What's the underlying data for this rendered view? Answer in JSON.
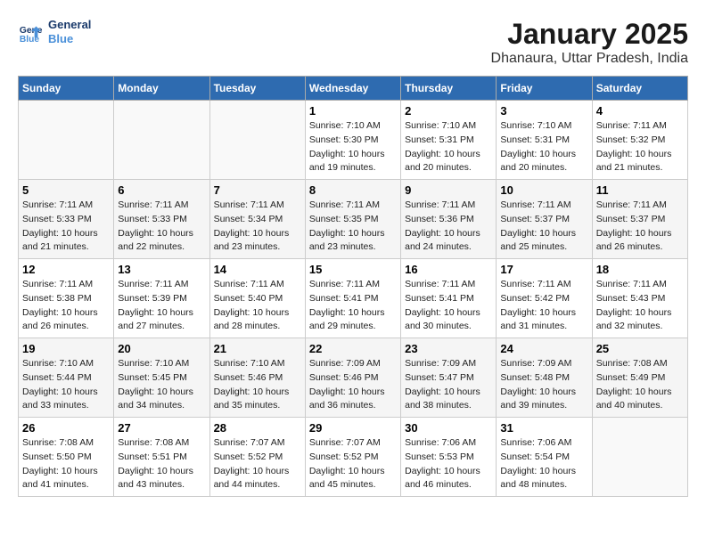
{
  "logo": {
    "line1": "General",
    "line2": "Blue"
  },
  "title": "January 2025",
  "subtitle": "Dhanaura, Uttar Pradesh, India",
  "days_of_week": [
    "Sunday",
    "Monday",
    "Tuesday",
    "Wednesday",
    "Thursday",
    "Friday",
    "Saturday"
  ],
  "weeks": [
    [
      {
        "num": "",
        "info": ""
      },
      {
        "num": "",
        "info": ""
      },
      {
        "num": "",
        "info": ""
      },
      {
        "num": "1",
        "info": "Sunrise: 7:10 AM\nSunset: 5:30 PM\nDaylight: 10 hours\nand 19 minutes."
      },
      {
        "num": "2",
        "info": "Sunrise: 7:10 AM\nSunset: 5:31 PM\nDaylight: 10 hours\nand 20 minutes."
      },
      {
        "num": "3",
        "info": "Sunrise: 7:10 AM\nSunset: 5:31 PM\nDaylight: 10 hours\nand 20 minutes."
      },
      {
        "num": "4",
        "info": "Sunrise: 7:11 AM\nSunset: 5:32 PM\nDaylight: 10 hours\nand 21 minutes."
      }
    ],
    [
      {
        "num": "5",
        "info": "Sunrise: 7:11 AM\nSunset: 5:33 PM\nDaylight: 10 hours\nand 21 minutes."
      },
      {
        "num": "6",
        "info": "Sunrise: 7:11 AM\nSunset: 5:33 PM\nDaylight: 10 hours\nand 22 minutes."
      },
      {
        "num": "7",
        "info": "Sunrise: 7:11 AM\nSunset: 5:34 PM\nDaylight: 10 hours\nand 23 minutes."
      },
      {
        "num": "8",
        "info": "Sunrise: 7:11 AM\nSunset: 5:35 PM\nDaylight: 10 hours\nand 23 minutes."
      },
      {
        "num": "9",
        "info": "Sunrise: 7:11 AM\nSunset: 5:36 PM\nDaylight: 10 hours\nand 24 minutes."
      },
      {
        "num": "10",
        "info": "Sunrise: 7:11 AM\nSunset: 5:37 PM\nDaylight: 10 hours\nand 25 minutes."
      },
      {
        "num": "11",
        "info": "Sunrise: 7:11 AM\nSunset: 5:37 PM\nDaylight: 10 hours\nand 26 minutes."
      }
    ],
    [
      {
        "num": "12",
        "info": "Sunrise: 7:11 AM\nSunset: 5:38 PM\nDaylight: 10 hours\nand 26 minutes."
      },
      {
        "num": "13",
        "info": "Sunrise: 7:11 AM\nSunset: 5:39 PM\nDaylight: 10 hours\nand 27 minutes."
      },
      {
        "num": "14",
        "info": "Sunrise: 7:11 AM\nSunset: 5:40 PM\nDaylight: 10 hours\nand 28 minutes."
      },
      {
        "num": "15",
        "info": "Sunrise: 7:11 AM\nSunset: 5:41 PM\nDaylight: 10 hours\nand 29 minutes."
      },
      {
        "num": "16",
        "info": "Sunrise: 7:11 AM\nSunset: 5:41 PM\nDaylight: 10 hours\nand 30 minutes."
      },
      {
        "num": "17",
        "info": "Sunrise: 7:11 AM\nSunset: 5:42 PM\nDaylight: 10 hours\nand 31 minutes."
      },
      {
        "num": "18",
        "info": "Sunrise: 7:11 AM\nSunset: 5:43 PM\nDaylight: 10 hours\nand 32 minutes."
      }
    ],
    [
      {
        "num": "19",
        "info": "Sunrise: 7:10 AM\nSunset: 5:44 PM\nDaylight: 10 hours\nand 33 minutes."
      },
      {
        "num": "20",
        "info": "Sunrise: 7:10 AM\nSunset: 5:45 PM\nDaylight: 10 hours\nand 34 minutes."
      },
      {
        "num": "21",
        "info": "Sunrise: 7:10 AM\nSunset: 5:46 PM\nDaylight: 10 hours\nand 35 minutes."
      },
      {
        "num": "22",
        "info": "Sunrise: 7:09 AM\nSunset: 5:46 PM\nDaylight: 10 hours\nand 36 minutes."
      },
      {
        "num": "23",
        "info": "Sunrise: 7:09 AM\nSunset: 5:47 PM\nDaylight: 10 hours\nand 38 minutes."
      },
      {
        "num": "24",
        "info": "Sunrise: 7:09 AM\nSunset: 5:48 PM\nDaylight: 10 hours\nand 39 minutes."
      },
      {
        "num": "25",
        "info": "Sunrise: 7:08 AM\nSunset: 5:49 PM\nDaylight: 10 hours\nand 40 minutes."
      }
    ],
    [
      {
        "num": "26",
        "info": "Sunrise: 7:08 AM\nSunset: 5:50 PM\nDaylight: 10 hours\nand 41 minutes."
      },
      {
        "num": "27",
        "info": "Sunrise: 7:08 AM\nSunset: 5:51 PM\nDaylight: 10 hours\nand 43 minutes."
      },
      {
        "num": "28",
        "info": "Sunrise: 7:07 AM\nSunset: 5:52 PM\nDaylight: 10 hours\nand 44 minutes."
      },
      {
        "num": "29",
        "info": "Sunrise: 7:07 AM\nSunset: 5:52 PM\nDaylight: 10 hours\nand 45 minutes."
      },
      {
        "num": "30",
        "info": "Sunrise: 7:06 AM\nSunset: 5:53 PM\nDaylight: 10 hours\nand 46 minutes."
      },
      {
        "num": "31",
        "info": "Sunrise: 7:06 AM\nSunset: 5:54 PM\nDaylight: 10 hours\nand 48 minutes."
      },
      {
        "num": "",
        "info": ""
      }
    ]
  ]
}
